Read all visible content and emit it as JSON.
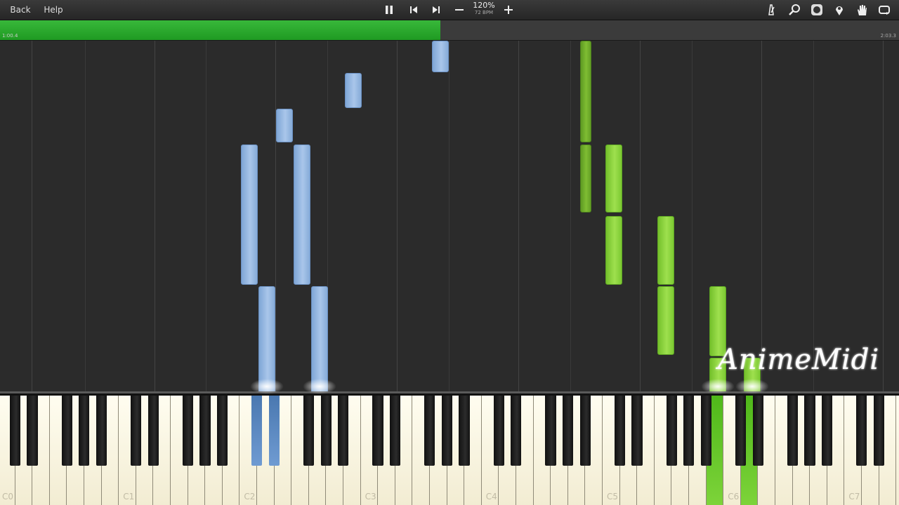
{
  "toolbar": {
    "back_label": "Back",
    "help_label": "Help",
    "zoom": "120%",
    "bpm": "72 BPM",
    "icons": [
      "pause-icon",
      "skip-back-icon",
      "skip-forward-icon",
      "minus-icon",
      "plus-icon",
      "metronome-icon",
      "search-icon",
      "settings-dial-icon",
      "location-pin-icon",
      "hand-icon",
      "loop-icon"
    ]
  },
  "progress": {
    "fraction": 0.49,
    "start_time": "1:00.4",
    "end_time": "2:03.3",
    "color": "#2aa82d"
  },
  "colors": {
    "left_hand": "#9dbfe6",
    "right_hand": "#8ed646"
  },
  "keyboard": {
    "octave_labels": [
      "C0",
      "C1",
      "C2",
      "C3",
      "C4",
      "C5",
      "C6",
      "C7"
    ],
    "pressed_blue": [
      "C#2",
      "D#2"
    ],
    "pressed_green": [
      "B5",
      "D6"
    ]
  },
  "watermark": "AnimeMidi"
}
